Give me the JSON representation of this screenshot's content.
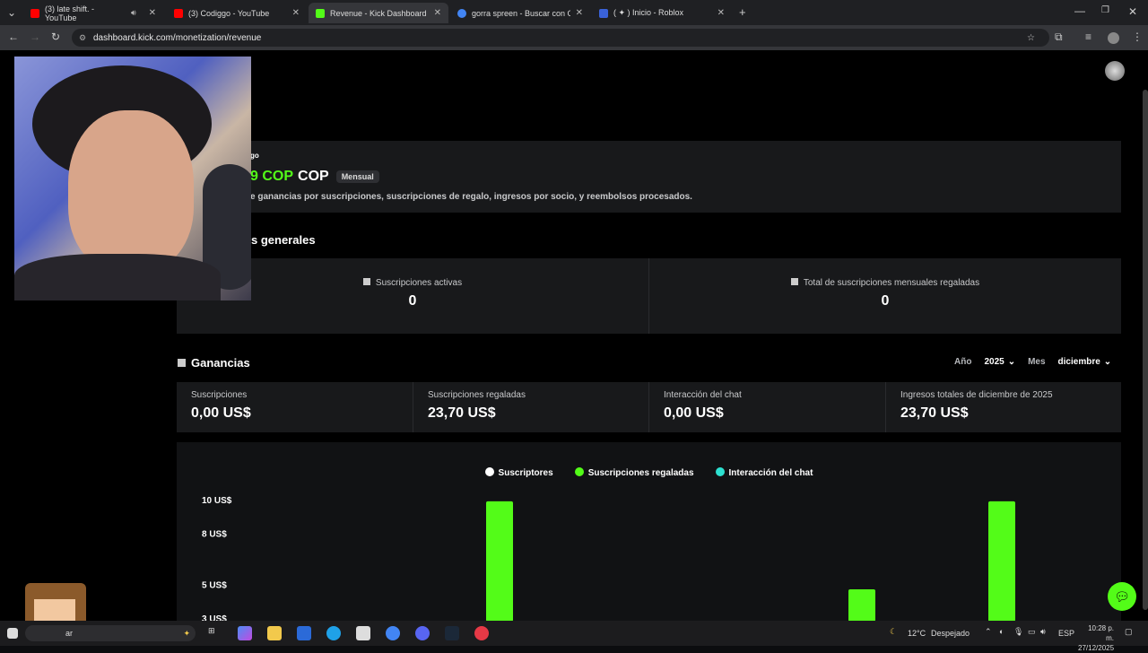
{
  "browser": {
    "tabs": [
      {
        "title": "(3) late shift. - YouTube",
        "favicon_color": "#ff0000"
      },
      {
        "title": "(3) Codiggo - YouTube",
        "favicon_color": "#ff0000"
      },
      {
        "title": "Revenue - Kick Dashboard",
        "favicon_color": "#53fc18"
      },
      {
        "title": "gorra spreen - Buscar con Goo",
        "favicon_color": "#4285f4"
      },
      {
        "title": "( ✦ ) Inicio - Roblox",
        "favicon_color": "#3a62d8"
      }
    ],
    "url": "dashboard.kick.com/monetization/revenue"
  },
  "balance": {
    "label": "go",
    "amount_partial": "9 COP",
    "currency": "COP",
    "badge": "Mensual",
    "description": "e ganancias por suscripciones, suscripciones de regalo, ingresos por socio, y reembolsos procesados."
  },
  "overview": {
    "title": "s generales",
    "stats": [
      {
        "label": "Suscripciones activas",
        "value": "0"
      },
      {
        "label": "Total de suscripciones mensuales regaladas",
        "value": "0"
      }
    ]
  },
  "earnings": {
    "title": "Ganancias",
    "year_label": "Año",
    "year_value": "2025",
    "month_label": "Mes",
    "month_value": "diciembre",
    "stats": [
      {
        "label": "Suscripciones",
        "value": "0,00 US$"
      },
      {
        "label": "Suscripciones regaladas",
        "value": "23,70 US$"
      },
      {
        "label": "Interacción del chat",
        "value": "0,00 US$"
      },
      {
        "label": "Ingresos totales de diciembre de 2025",
        "value": "23,70 US$"
      }
    ]
  },
  "chart_data": {
    "type": "bar",
    "legend": [
      "Suscriptores",
      "Suscripciones regaladas",
      "Interacción del chat"
    ],
    "legend_colors": [
      "#ffffff",
      "#53fc18",
      "#2de0d0"
    ],
    "y_ticks": [
      "10 US$",
      "8 US$",
      "5 US$",
      "3 US$"
    ],
    "series": [
      {
        "name": "Suscripciones regaladas",
        "values": [
          9.9,
          4.7,
          9.9
        ]
      }
    ],
    "bar_color": "#53fc18",
    "ylim": [
      3,
      10
    ]
  },
  "taskbar": {
    "search_text": "ar",
    "weather": "12°C",
    "weather_desc": "Despejado",
    "lang": "ESP",
    "time": "10:28 p. m.",
    "date": "27/12/2025"
  }
}
